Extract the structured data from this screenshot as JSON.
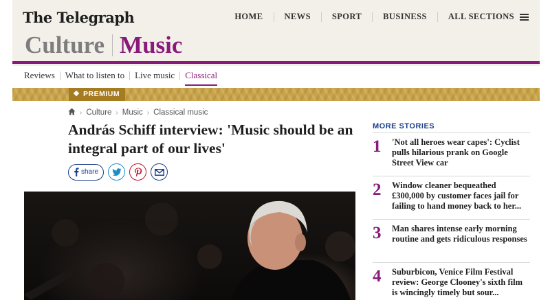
{
  "brand": {
    "logo": "The Telegraph"
  },
  "top_nav": [
    {
      "label": "HOME"
    },
    {
      "label": "NEWS"
    },
    {
      "label": "SPORT"
    },
    {
      "label": "BUSINESS"
    },
    {
      "label": "ALL SECTIONS"
    }
  ],
  "section": {
    "parent": "Culture",
    "current": "Music",
    "accent": "#8a1a7a"
  },
  "sub_nav": [
    {
      "label": "Reviews"
    },
    {
      "label": "What to listen to"
    },
    {
      "label": "Live music"
    },
    {
      "label": "Classical"
    }
  ],
  "premium": {
    "label": "PREMIUM",
    "color": "#c9a346"
  },
  "breadcrumb": {
    "items": [
      "Culture",
      "Music",
      "Classical music"
    ]
  },
  "article": {
    "headline": "András Schiff interview: 'Music should be an integral part of our lives'",
    "share_label": "share"
  },
  "more_stories": {
    "heading": "MORE STORIES",
    "items": [
      {
        "num": "1",
        "title": "'Not all heroes wear capes': Cyclist pulls hilarious prank on Google Street View car"
      },
      {
        "num": "2",
        "title": "Window cleaner bequeathed £300,000 by customer faces jail for failing to hand money back to her..."
      },
      {
        "num": "3",
        "title": "Man shares intense early morning routine and gets ridiculous responses"
      },
      {
        "num": "4",
        "title": "Suburbicon, Venice Film Festival review: George Clooney's sixth film is wincingly timely but sour..."
      }
    ]
  }
}
